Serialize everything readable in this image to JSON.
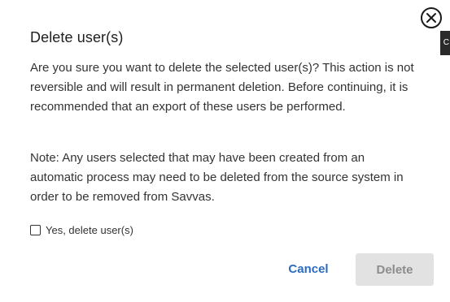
{
  "dialog": {
    "title": "Delete user(s)",
    "warning_text": "Are you sure you want to delete the selected user(s)? This action is not reversible and will result in permanent deletion. Before continuing, it is recommended that an export of these users be performed.",
    "note_text": "Note: Any users selected that may have been created from an automatic process may need to be deleted from the source system in order to be removed from Savvas.",
    "confirm_checkbox": {
      "label": "Yes, delete user(s)",
      "checked": false
    },
    "actions": {
      "cancel_label": "Cancel",
      "delete_label": "Delete",
      "delete_disabled": true
    },
    "close_icon": "close-circle-icon"
  },
  "side_tab": {
    "label": "C"
  },
  "colors": {
    "link_blue": "#2a6bbf",
    "disabled_bg": "#e2e2e2",
    "disabled_text": "#8c8c8c",
    "text": "#333333"
  }
}
